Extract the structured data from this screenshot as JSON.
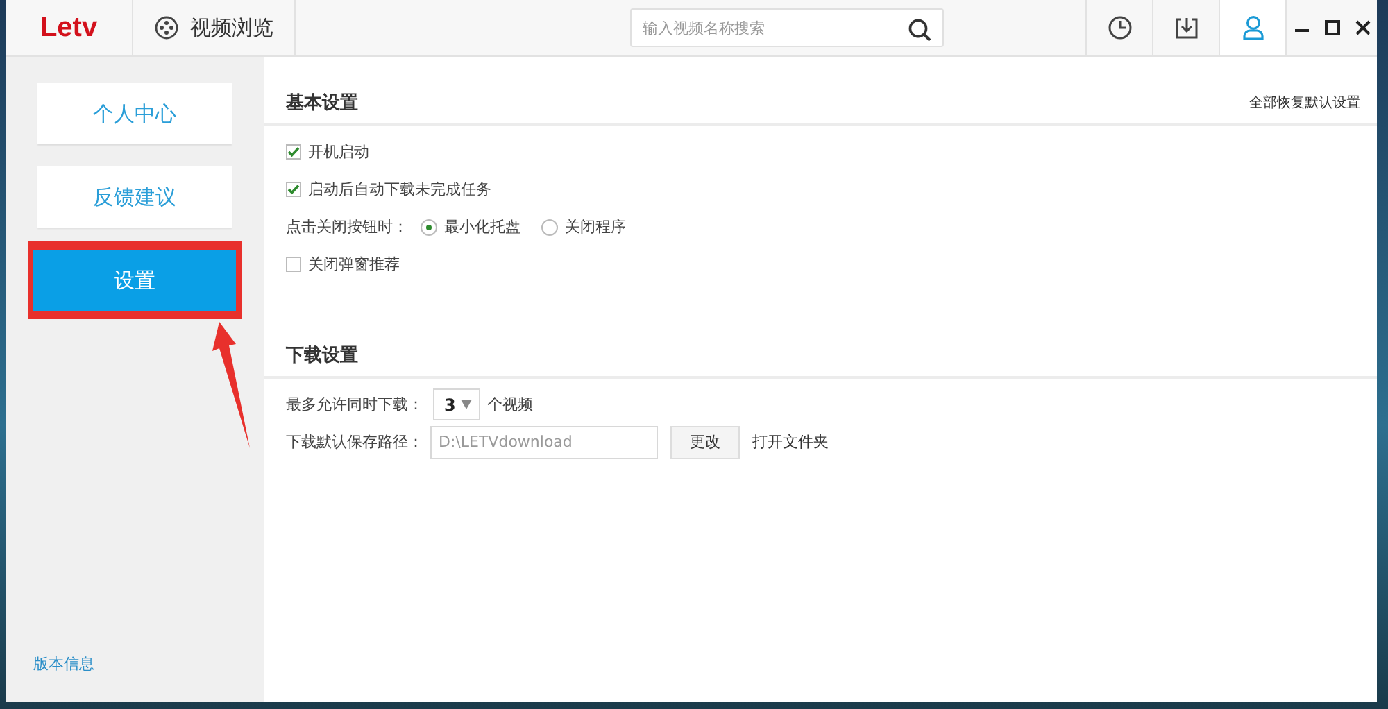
{
  "app": {
    "logo": "Letv",
    "nav_tab": {
      "label": "视频浏览"
    }
  },
  "search": {
    "placeholder": "输入视频名称搜索"
  },
  "toolbar": [
    {
      "kind": "history",
      "selected": false
    },
    {
      "kind": "download",
      "selected": false
    },
    {
      "kind": "user",
      "selected": true
    }
  ],
  "sidebar": {
    "items": [
      {
        "label": "个人中心",
        "selected": false,
        "highlighted": false
      },
      {
        "label": "反馈建议",
        "selected": false,
        "highlighted": false
      },
      {
        "label": "设置",
        "selected": true,
        "highlighted": true
      }
    ],
    "version_link": "版本信息"
  },
  "annotation_arrow": true,
  "basic_settings": {
    "title": "基本设置",
    "reset_link": "全部恢复默认设置",
    "options": [
      {
        "kind": "checkbox",
        "label": "开机启动",
        "checked": true
      },
      {
        "kind": "checkbox",
        "label": "启动后自动下载未完成任务",
        "checked": true
      },
      {
        "kind": "radio-group",
        "label": "点击关闭按钮时：",
        "choices": [
          {
            "label": "最小化托盘",
            "selected": true
          },
          {
            "label": "关闭程序",
            "selected": false
          }
        ]
      },
      {
        "kind": "checkbox",
        "label": "关闭弹窗推荐",
        "checked": false
      }
    ]
  },
  "download_settings": {
    "title": "下载设置",
    "rows": [
      {
        "kind": "select",
        "label": "最多允许同时下载：",
        "value": "3",
        "suffix": "个视频"
      },
      {
        "kind": "path",
        "label": "下载默认保存路径：",
        "value": "D:\\LETVdownload",
        "button": "更改",
        "link": "打开文件夹"
      }
    ]
  }
}
